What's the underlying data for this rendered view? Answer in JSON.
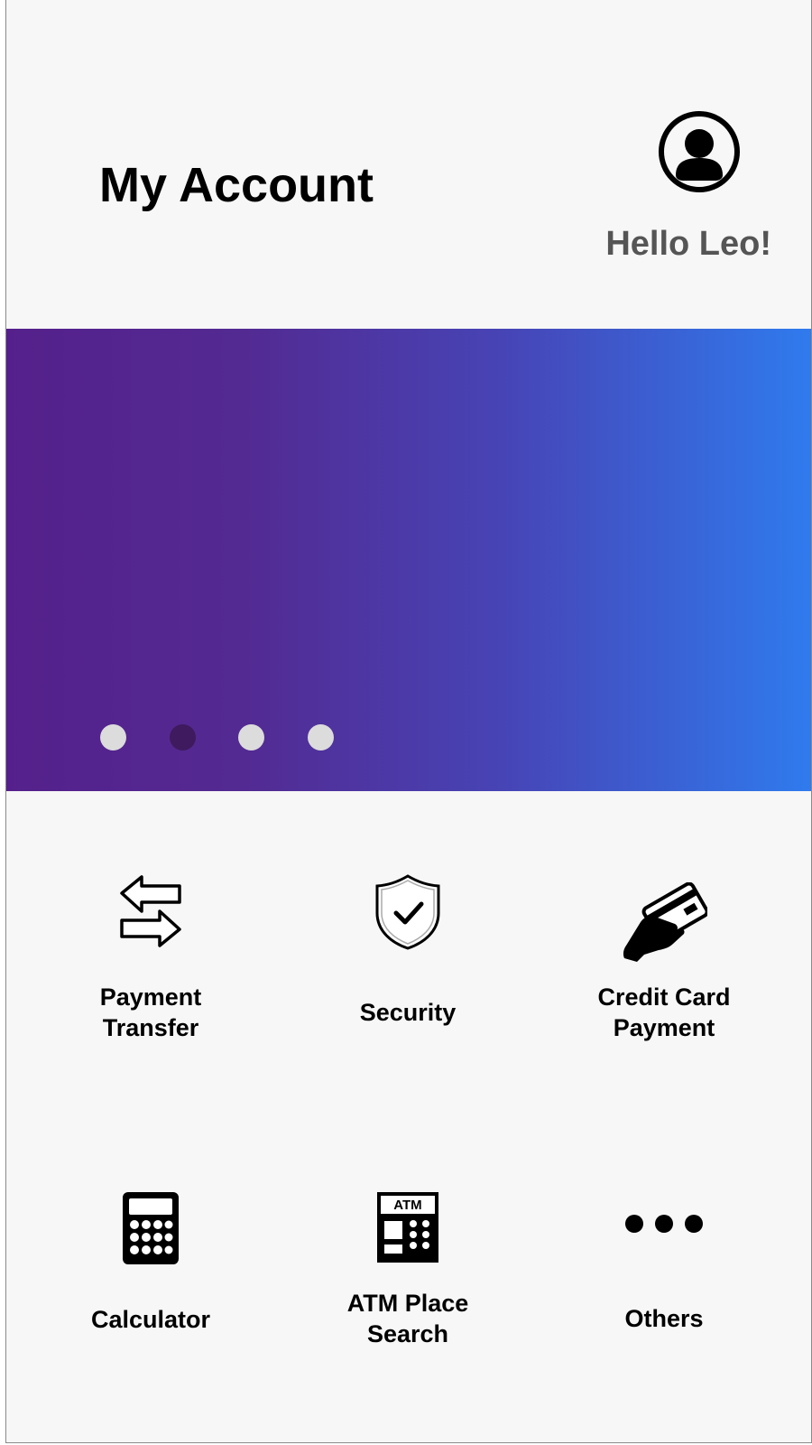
{
  "header": {
    "title": "My Account",
    "greeting": "Hello Leo!",
    "avatar_icon": "user-circle-icon"
  },
  "banner": {
    "gradient_start": "#55208b",
    "gradient_end": "#2f7bee",
    "dots": [
      {
        "active": false
      },
      {
        "active": true
      },
      {
        "active": false
      },
      {
        "active": false
      }
    ],
    "dot_color": "#dcdcdc",
    "dot_active_color": "#3f1a5e"
  },
  "menu": {
    "items": [
      {
        "label_line1": "Payment",
        "label_line2": "Transfer",
        "icon": "transfer-arrows-icon"
      },
      {
        "label_line1": "Security",
        "label_line2": "",
        "icon": "shield-check-icon"
      },
      {
        "label_line1": "Credit Card",
        "label_line2": "Payment",
        "icon": "hand-credit-card-icon"
      },
      {
        "label_line1": "Calculator",
        "label_line2": "",
        "icon": "calculator-icon"
      },
      {
        "label_line1": "ATM Place",
        "label_line2": "Search",
        "icon": "atm-icon",
        "icon_text": "ATM"
      },
      {
        "label_line1": "Others",
        "label_line2": "",
        "icon": "more-dots-icon"
      }
    ]
  }
}
